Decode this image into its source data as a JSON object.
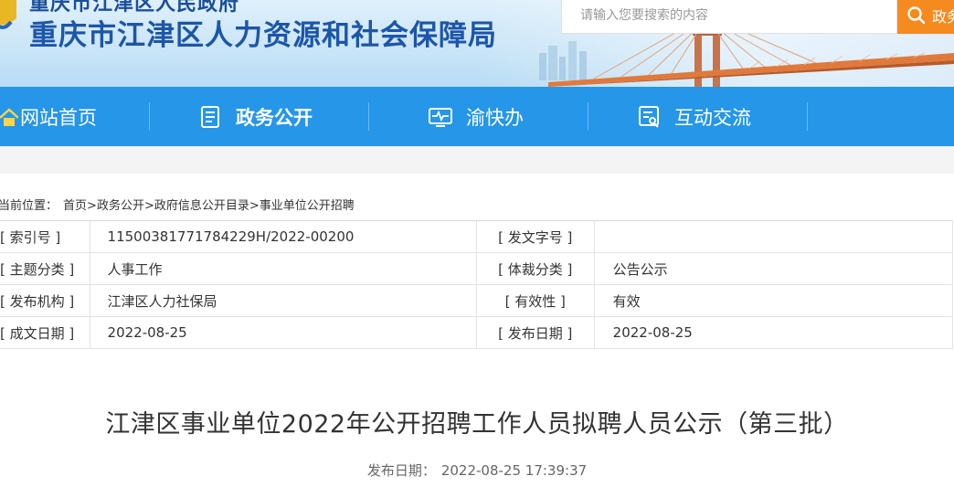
{
  "header": {
    "subtitle": "重庆市江津区人民政府",
    "title": "重庆市江津区人力资源和社会保障局",
    "search_placeholder": "请输入您要搜索的内容",
    "search_button": "政务"
  },
  "nav": {
    "items": [
      {
        "label": "网站首页",
        "icon": "home-icon",
        "active": false
      },
      {
        "label": "政务公开",
        "icon": "document-icon",
        "active": true
      },
      {
        "label": "渝快办",
        "icon": "monitor-icon",
        "active": false
      },
      {
        "label": "互动交流",
        "icon": "chat-form-icon",
        "active": false
      }
    ]
  },
  "breadcrumb": {
    "prefix": "当前位置：",
    "items": [
      "首页",
      "政务公开",
      "政府信息公开目录",
      "事业单位公开招聘"
    ],
    "separator": ">"
  },
  "info": {
    "rows": [
      {
        "k1": "[ 索引号 ]",
        "v1": "11500381771784229H/2022-00200",
        "k2": "[ 发文字号 ]",
        "v2": ""
      },
      {
        "k1": "[ 主题分类 ]",
        "v1": "人事工作",
        "k2": "[ 体裁分类 ]",
        "v2": "公告公示"
      },
      {
        "k1": "[ 发布机构 ]",
        "v1": "江津区人力社保局",
        "k2": "[ 有效性 ]",
        "v2": "有效"
      },
      {
        "k1": "[ 成文日期 ]",
        "v1": "2022-08-25",
        "k2": "[ 发布日期 ]",
        "v2": "2022-08-25"
      }
    ]
  },
  "article": {
    "title": "江津区事业单位2022年公开招聘工作人员拟聘人员公示（第三批）",
    "publish_label": "发布日期：",
    "publish_datetime": "2022-08-25 17:39:37"
  },
  "colors": {
    "nav_bg": "#2596e8",
    "title_blue": "#1c56a8",
    "search_orange": "#f58a1f"
  }
}
